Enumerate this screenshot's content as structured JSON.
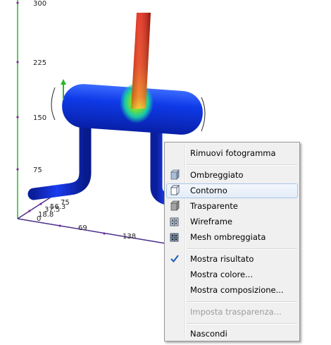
{
  "viewport": {
    "axis_labels": {
      "z_300": "300",
      "z_225": "225",
      "z_150": "150",
      "z_75": "75",
      "x_69": "69",
      "x_138": "138",
      "y_75": "75",
      "y_56": "56.3",
      "y_37": "37.5",
      "y_18": "18.8",
      "origin": "0"
    },
    "colors": {
      "vertical_axis": "#22bb22",
      "floor_axis": "#4a2e8a",
      "pipe_low": "#0a2bd6",
      "pipe_high": "#e82010"
    }
  },
  "context_menu": {
    "items": [
      {
        "label": "Rimuovi fotogramma",
        "icon": ""
      },
      {
        "label": "Ombreggiato",
        "icon": "shaded-cube-icon"
      },
      {
        "label": "Contorno",
        "icon": "outline-cube-icon"
      },
      {
        "label": "Trasparente",
        "icon": "transparent-cube-icon"
      },
      {
        "label": "Wireframe",
        "icon": "wireframe-cube-icon"
      },
      {
        "label": "Mesh ombreggiata",
        "icon": "shaded-mesh-icon"
      },
      {
        "label": "Mostra risultato",
        "icon": "checkmark-icon"
      },
      {
        "label": "Mostra colore...",
        "icon": ""
      },
      {
        "label": "Mostra composizione...",
        "icon": ""
      },
      {
        "label": "Imposta trasparenza...",
        "icon": ""
      },
      {
        "label": "Nascondi",
        "icon": ""
      }
    ],
    "hovered_item": "Contorno",
    "checked_item": "Mostra risultato",
    "disabled_item": "Imposta trasparenza..."
  }
}
